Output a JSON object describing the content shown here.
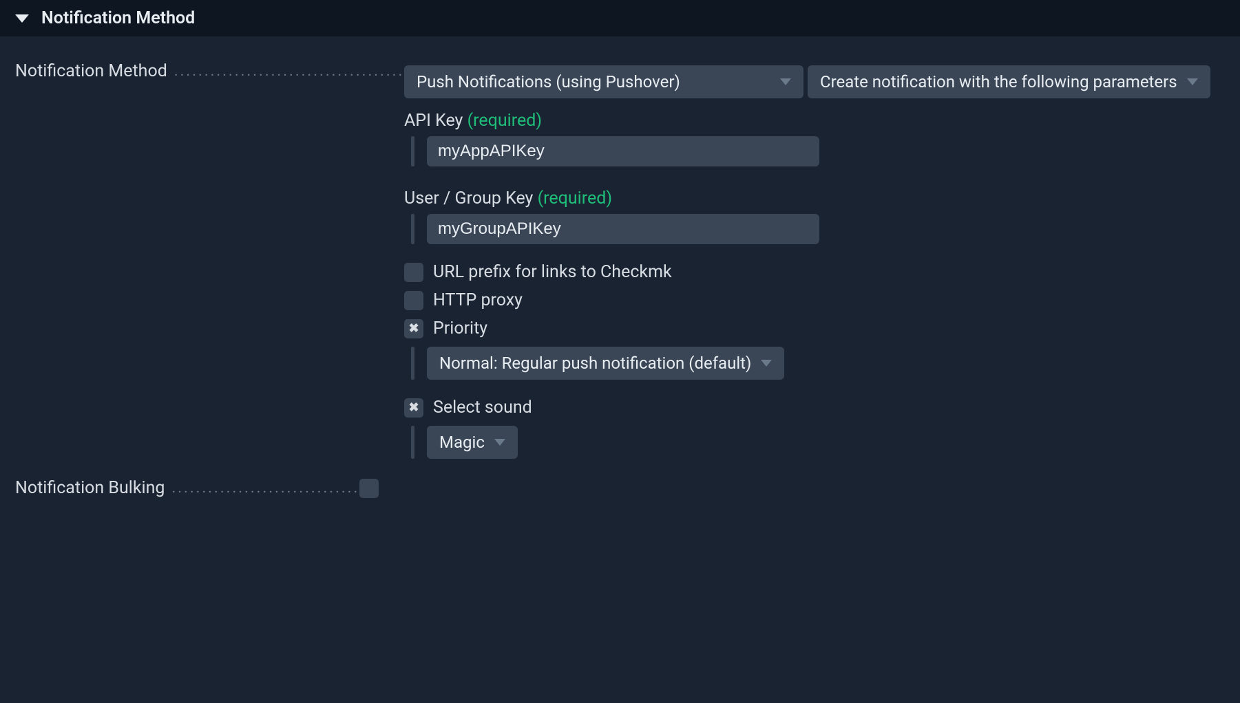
{
  "section": {
    "title": "Notification Method"
  },
  "form": {
    "method_label": "Notification Method",
    "method_select": "Push Notifications (using Pushover)",
    "params_select": "Create notification with the following parameters",
    "api_key": {
      "label": "API Key",
      "required": "(required)",
      "value": "myAppAPIKey"
    },
    "group_key": {
      "label": "User / Group Key",
      "required": "(required)",
      "value": "myGroupAPIKey"
    },
    "url_prefix_label": "URL prefix for links to Checkmk",
    "http_proxy_label": "HTTP proxy",
    "priority_label": "Priority",
    "priority_select": "Normal: Regular push notification (default)",
    "sound_label": "Select sound",
    "sound_select": "Magic",
    "bulking_label": "Notification Bulking"
  }
}
